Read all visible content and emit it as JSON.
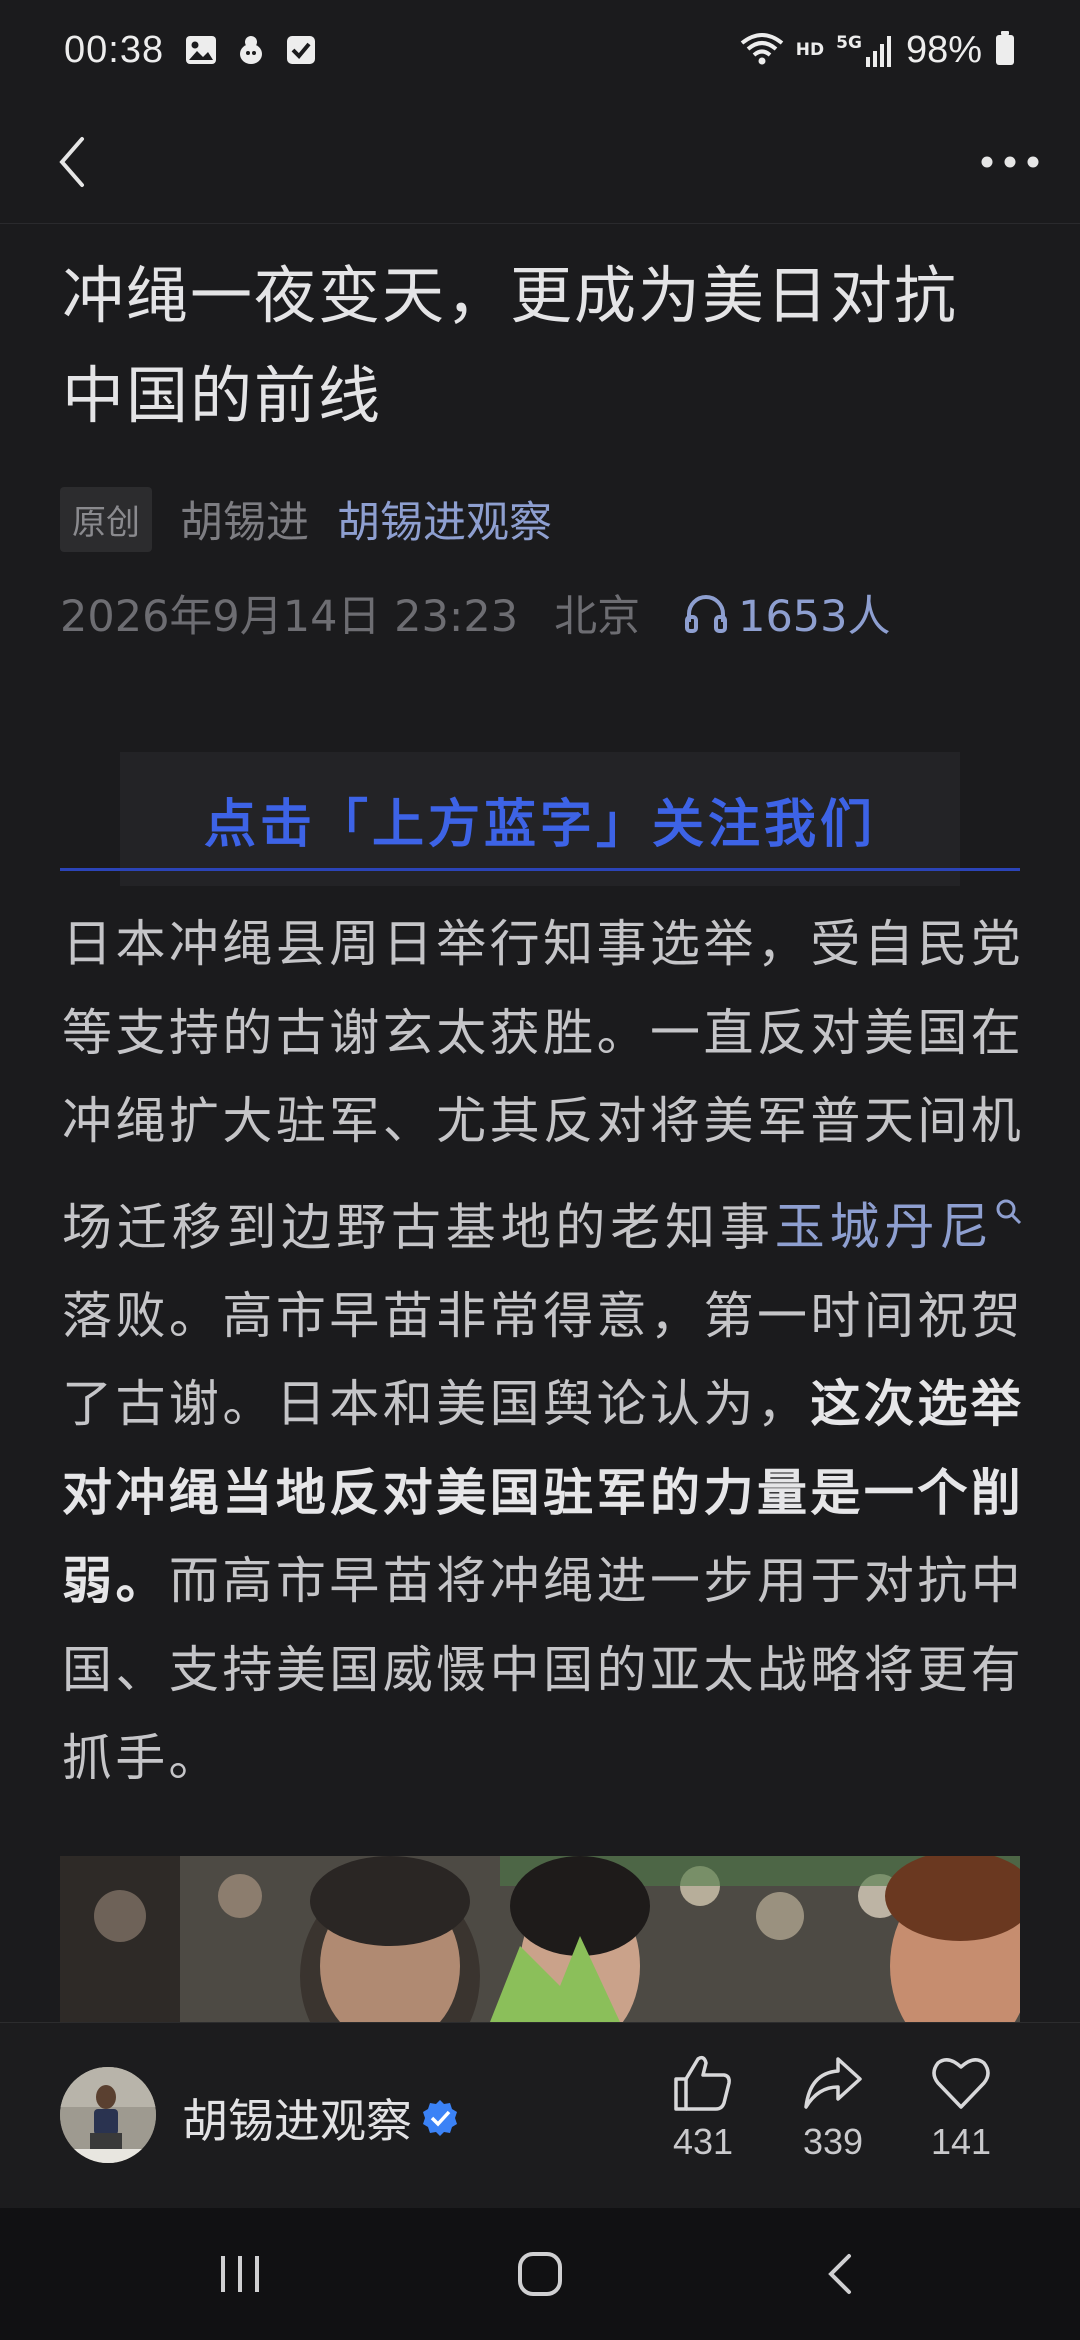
{
  "status_bar": {
    "time": "00:38",
    "network_label": "HD",
    "signal_label": "5G",
    "battery": "98%"
  },
  "article": {
    "title": "冲绳一夜变天，更成为美日对抗中国的前线",
    "tag": "原创",
    "author": "胡锡进",
    "account": "胡锡进观察",
    "datetime": "2026年9月14日 23:23",
    "location": "北京",
    "listeners": "1653人",
    "follow_banner": "点击「上方蓝字」关注我们",
    "body": {
      "p1": "日本冲绳县周日举行知事选举，受自民党等支持的古谢玄太获胜。一直反对美国在冲绳扩大驻军、尤其反对将美军普天间机场迁移到边野古基地的老知事",
      "link": "玉城丹尼",
      "p2": "落败。高市早苗非常得意，第一时间祝贺了古谢。日本和美国舆论认为，",
      "bold": "这次选举对冲绳当地反对美国驻军的力量是一个削弱。",
      "p3": "而高市早苗将冲绳进一步用于对抗中国、支持美国威慑中国的亚太战略将更有抓手。"
    }
  },
  "action_bar": {
    "account_name": "胡锡进观察",
    "likes": "431",
    "shares": "339",
    "favorites": "141"
  },
  "colors": {
    "background": "#1b1b1d",
    "link": "#8e9fd0",
    "follow_blue": "#3d63e6",
    "verified": "#3b82f6"
  }
}
